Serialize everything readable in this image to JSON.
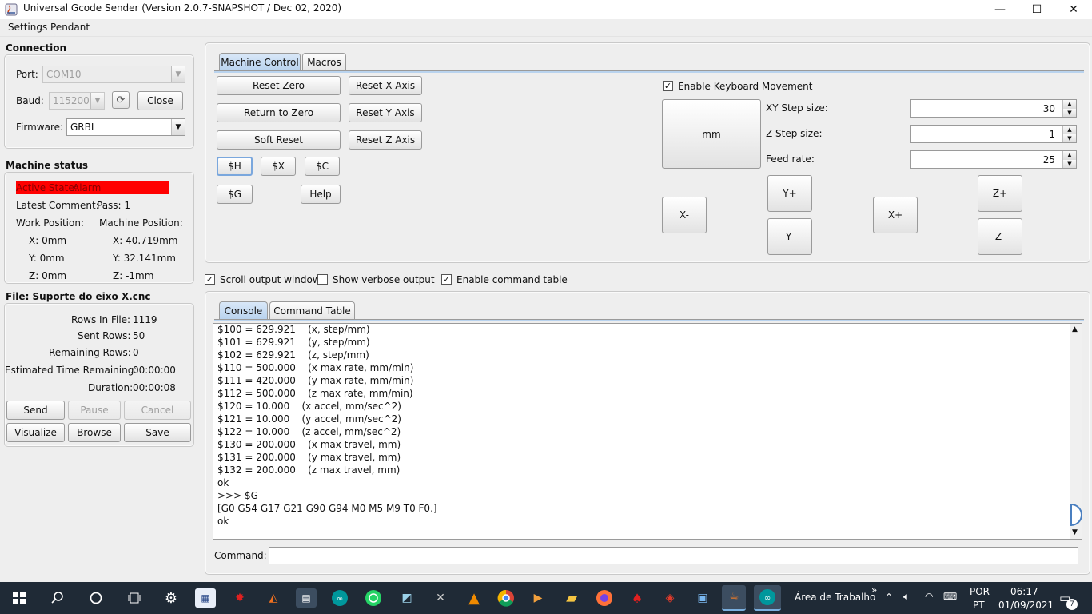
{
  "window": {
    "title": "Universal Gcode Sender (Version 2.0.7-SNAPSHOT / Dec 02, 2020)",
    "minimize": "—",
    "maximize": "☐",
    "close": "✕"
  },
  "menu": {
    "settings": "Settings",
    "pendant": "Pendant"
  },
  "connection": {
    "title": "Connection",
    "port_label": "Port:",
    "port_value": "COM10",
    "baud_label": "Baud:",
    "baud_value": "115200",
    "close_button": "Close",
    "firmware_label": "Firmware:",
    "firmware_value": "GRBL"
  },
  "machine_status": {
    "title": "Machine status",
    "active_state_label": "Active State:",
    "active_state_value": "Alarm",
    "latest_comment": "Latest Comment:",
    "pass": "Pass: 1",
    "work_position": "Work Position:",
    "machine_position": "Machine Position:",
    "work_x": "X:  0mm",
    "work_y": "Y:  0mm",
    "work_z": "Z:  0mm",
    "mach_x": "X:  40.719mm",
    "mach_y": "Y:  32.141mm",
    "mach_z": "Z:  -1mm",
    "alarm_color": "#ff0000"
  },
  "file": {
    "title": "File: Suporte do eixo X.cnc",
    "rows_label": "Rows In File:",
    "rows_value": "1119",
    "sent_label": "Sent Rows:",
    "sent_value": "50",
    "remaining_label": "Remaining Rows:",
    "remaining_value": "0",
    "est_label": "Estimated Time Remaining:",
    "est_value": "00:00:00",
    "duration_label": "Duration:",
    "duration_value": "00:00:08",
    "send": "Send",
    "pause": "Pause",
    "cancel": "Cancel",
    "visualize": "Visualize",
    "browse": "Browse",
    "save": "Save"
  },
  "control_tabs": {
    "machine_control": "Machine Control",
    "macros": "Macros"
  },
  "machine_control": {
    "reset_zero": "Reset Zero",
    "return_to_zero": "Return to Zero",
    "soft_reset": "Soft Reset",
    "reset_x": "Reset X Axis",
    "reset_y": "Reset Y Axis",
    "reset_z": "Reset Z Axis",
    "cmd_h": "$H",
    "cmd_x": "$X",
    "cmd_c": "$C",
    "cmd_g": "$G",
    "help": "Help",
    "enable_keyboard": "Enable Keyboard Movement",
    "units": "mm",
    "xy_step_label": "XY Step size:",
    "xy_step_value": "30",
    "z_step_label": "Z Step size:",
    "z_step_value": "1",
    "feed_label": "Feed rate:",
    "feed_value": "25",
    "x_minus": "X-",
    "x_plus": "X+",
    "y_plus": "Y+",
    "y_minus": "Y-",
    "z_plus": "Z+",
    "z_minus": "Z-"
  },
  "options": {
    "scroll_output": "Scroll output window",
    "verbose": "Show verbose output",
    "command_table": "Enable command table"
  },
  "console_tabs": {
    "console": "Console",
    "command_table": "Command Table"
  },
  "console_lines": [
    "$100 = 629.921    (x, step/mm)",
    "$101 = 629.921    (y, step/mm)",
    "$102 = 629.921    (z, step/mm)",
    "$110 = 500.000    (x max rate, mm/min)",
    "$111 = 420.000    (y max rate, mm/min)",
    "$112 = 500.000    (z max rate, mm/min)",
    "$120 = 10.000    (x accel, mm/sec^2)",
    "$121 = 10.000    (y accel, mm/sec^2)",
    "$122 = 10.000    (z accel, mm/sec^2)",
    "$130 = 200.000    (x max travel, mm)",
    "$131 = 200.000    (y max travel, mm)",
    "$132 = 200.000    (z max travel, mm)",
    "ok",
    ">>> $G",
    "[G0 G54 G17 G21 G90 G94 M0 M5 M9 T0 F0.]",
    "ok"
  ],
  "command": {
    "label": "Command:",
    "value": ""
  },
  "taskbar": {
    "desktop_label": "Área de Trabalho",
    "chevron": "»",
    "lang_top": "POR",
    "lang_bottom": "PT",
    "time": "06:17",
    "date": "01/09/2021",
    "notification_count": "7"
  }
}
